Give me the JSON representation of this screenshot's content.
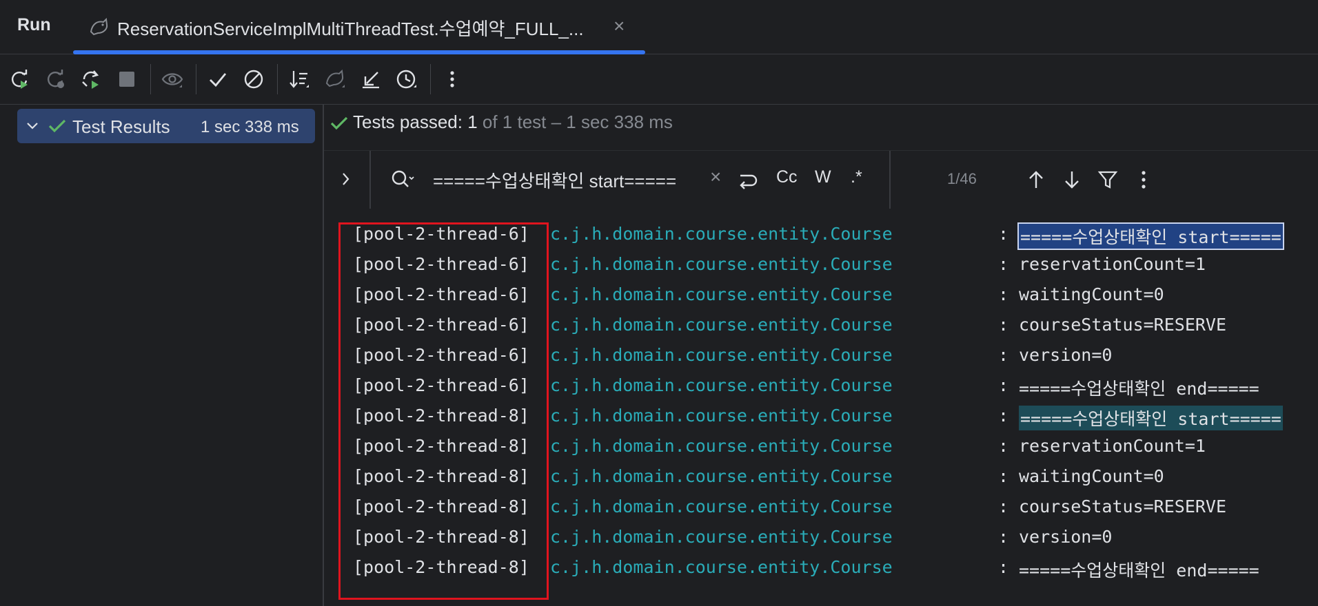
{
  "window": {
    "run_label": "Run",
    "tab_label": "ReservationServiceImplMultiThreadTest.수업예약_FULL_...",
    "tab_close": "×"
  },
  "toolbar": {
    "buttons": [
      "rerun-icon",
      "rerun-failed-icon",
      "rerun-auto-icon",
      "stop-icon",
      "show-passed-icon",
      "show-passed-check-icon",
      "show-ignored-icon",
      "sort-icon",
      "import-tests-icon",
      "collapse-icon",
      "history-icon",
      "more-icon"
    ]
  },
  "tree": {
    "label": "Test Results",
    "time": "1 sec 338 ms"
  },
  "status": {
    "passed": "Tests passed: 1",
    "rest": " of 1 test – 1 sec 338 ms"
  },
  "search": {
    "value": "=====수업상태확인 start=====",
    "clear": "×",
    "case_label": "Cc",
    "words_label": "W",
    "regex_label": ".*",
    "count": "1/46"
  },
  "console": {
    "lines": [
      {
        "thread": "[pool-2-thread-6]",
        "logger": "c.j.h.domain.course.entity.Course",
        "colon": ":",
        "msg": "=====수업상태확인 start=====",
        "highlight": "current"
      },
      {
        "thread": "[pool-2-thread-6]",
        "logger": "c.j.h.domain.course.entity.Course",
        "colon": ":",
        "msg": "reservationCount=1",
        "highlight": "none"
      },
      {
        "thread": "[pool-2-thread-6]",
        "logger": "c.j.h.domain.course.entity.Course",
        "colon": ":",
        "msg": "waitingCount=0",
        "highlight": "none"
      },
      {
        "thread": "[pool-2-thread-6]",
        "logger": "c.j.h.domain.course.entity.Course",
        "colon": ":",
        "msg": "courseStatus=RESERVE",
        "highlight": "none"
      },
      {
        "thread": "[pool-2-thread-6]",
        "logger": "c.j.h.domain.course.entity.Course",
        "colon": ":",
        "msg": "version=0",
        "highlight": "none"
      },
      {
        "thread": "[pool-2-thread-6]",
        "logger": "c.j.h.domain.course.entity.Course",
        "colon": ":",
        "msg": "=====수업상태확인 end=====",
        "highlight": "none"
      },
      {
        "thread": "[pool-2-thread-8]",
        "logger": "c.j.h.domain.course.entity.Course",
        "colon": ":",
        "msg": "=====수업상태확인 start=====",
        "highlight": "other"
      },
      {
        "thread": "[pool-2-thread-8]",
        "logger": "c.j.h.domain.course.entity.Course",
        "colon": ":",
        "msg": "reservationCount=1",
        "highlight": "none"
      },
      {
        "thread": "[pool-2-thread-8]",
        "logger": "c.j.h.domain.course.entity.Course",
        "colon": ":",
        "msg": "waitingCount=0",
        "highlight": "none"
      },
      {
        "thread": "[pool-2-thread-8]",
        "logger": "c.j.h.domain.course.entity.Course",
        "colon": ":",
        "msg": "courseStatus=RESERVE",
        "highlight": "none"
      },
      {
        "thread": "[pool-2-thread-8]",
        "logger": "c.j.h.domain.course.entity.Course",
        "colon": ":",
        "msg": "version=0",
        "highlight": "none"
      },
      {
        "thread": "[pool-2-thread-8]",
        "logger": "c.j.h.domain.course.entity.Course",
        "colon": ":",
        "msg": "=====수업상태확인 end=====",
        "highlight": "none"
      }
    ]
  },
  "colors": {
    "accent": "#3574f0",
    "success": "#5fb865",
    "logger": "#2aacb8",
    "annotation": "#e0141e"
  }
}
